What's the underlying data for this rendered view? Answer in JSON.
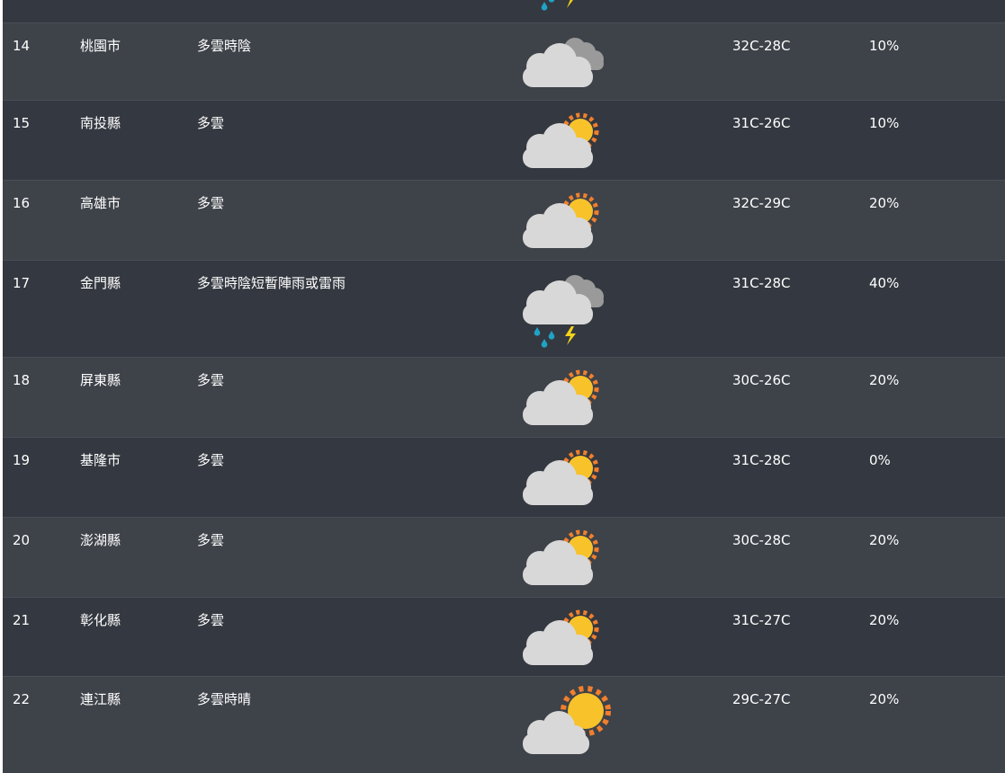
{
  "rows": [
    {
      "id": "",
      "city": "",
      "desc": "",
      "temp": "",
      "rain": "",
      "icon": "storm-icon"
    },
    {
      "id": "14",
      "city": "桃園市",
      "desc": "多雲時陰",
      "temp": "32C-28C",
      "rain": "10%",
      "icon": "overcast-icon"
    },
    {
      "id": "15",
      "city": "南投縣",
      "desc": "多雲",
      "temp": "31C-26C",
      "rain": "10%",
      "icon": "partly-cloudy-icon"
    },
    {
      "id": "16",
      "city": "高雄市",
      "desc": "多雲",
      "temp": "32C-29C",
      "rain": "20%",
      "icon": "partly-cloudy-icon"
    },
    {
      "id": "17",
      "city": "金門縣",
      "desc": "多雲時陰短暫陣雨或雷雨",
      "temp": "31C-28C",
      "rain": "40%",
      "icon": "storm-icon"
    },
    {
      "id": "18",
      "city": "屏東縣",
      "desc": "多雲",
      "temp": "30C-26C",
      "rain": "20%",
      "icon": "partly-cloudy-icon"
    },
    {
      "id": "19",
      "city": "基隆市",
      "desc": "多雲",
      "temp": "31C-28C",
      "rain": "0%",
      "icon": "partly-cloudy-icon"
    },
    {
      "id": "20",
      "city": "澎湖縣",
      "desc": "多雲",
      "temp": "30C-28C",
      "rain": "20%",
      "icon": "partly-cloudy-icon"
    },
    {
      "id": "21",
      "city": "彰化縣",
      "desc": "多雲",
      "temp": "31C-27C",
      "rain": "20%",
      "icon": "partly-cloudy-icon"
    },
    {
      "id": "22",
      "city": "連江縣",
      "desc": "多雲時晴",
      "temp": "29C-27C",
      "rain": "20%",
      "icon": "mostly-sunny-icon"
    }
  ]
}
